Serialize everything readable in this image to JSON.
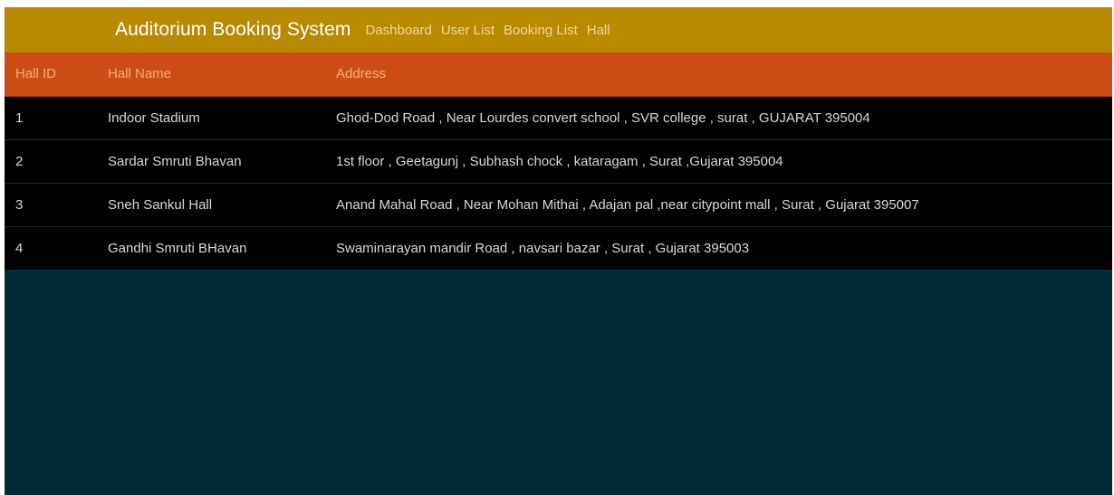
{
  "navbar": {
    "brand": "Auditorium Booking System",
    "links": [
      "Dashboard",
      "User List",
      "Booking List",
      "Hall"
    ]
  },
  "table": {
    "headers": [
      "Hall ID",
      "Hall Name",
      "Address"
    ],
    "rows": [
      {
        "id": "1",
        "name": "Indoor Stadium",
        "address": "Ghod-Dod Road , Near Lourdes convert school , SVR college , surat , GUJARAT 395004"
      },
      {
        "id": "2",
        "name": "Sardar Smruti Bhavan",
        "address": "1st floor , Geetagunj , Subhash chock , kataragam , Surat ,Gujarat 395004"
      },
      {
        "id": "3",
        "name": "Sneh Sankul Hall",
        "address": "Anand Mahal Road , Near Mohan Mithai , Adajan pal ,near citypoint mall , Surat , Gujarat 395007"
      },
      {
        "id": "4",
        "name": "Gandhi Smruti BHavan",
        "address": "Swaminarayan mandir Road , navsari bazar , Surat , Gujarat 395003"
      }
    ]
  },
  "colors": {
    "navbar_bg": "#b88a00",
    "header_bg": "#cc4d15",
    "row_bg": "#000000",
    "page_bg": "#022b3a"
  }
}
